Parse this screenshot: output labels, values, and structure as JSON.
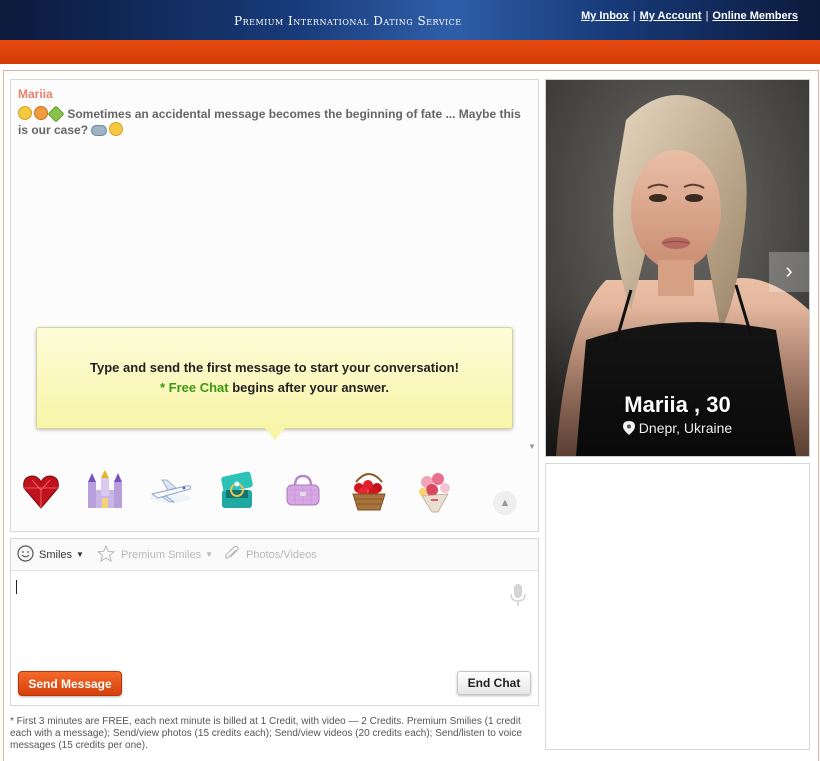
{
  "header": {
    "brand": "Premium International Dating Service",
    "links": [
      "My Inbox",
      "My Account",
      "Online Members"
    ]
  },
  "chat": {
    "sender": "Mariia",
    "message": "Sometimes an accidental message becomes the beginning of fate ... Maybe this is our case?",
    "tooltip_line1": "Type and send the first message to start your conversation!",
    "tooltip_free": "* Free Chat",
    "tooltip_line2_rest": " begins after your answer."
  },
  "gifts": [
    "heart-gem-icon",
    "castle-icon",
    "airplane-icon",
    "ring-box-icon",
    "handbag-icon",
    "rose-basket-icon",
    "bouquet-icon"
  ],
  "toolbar": {
    "smiles": "Smiles",
    "premium_smiles": "Premium Smiles",
    "photos_videos": "Photos/Videos"
  },
  "composer": {
    "value": "",
    "send_label": "Send Message",
    "end_label": "End Chat"
  },
  "note": "* First 3 minutes are FREE, each next minute is billed at 1 Credit, with video — 2 Credits. Premium Smilies (1 credit each with a message); Send/view photos (15 credits each); Send/view videos (20 credits each); Send/listen to voice messages (15 credits per one).",
  "profile": {
    "name_age": "Mariia , 30",
    "location": "Dnepr, Ukraine"
  },
  "colors": {
    "header_bg": "#173a78",
    "red_bar": "#d43a05",
    "send_button": "#e5531a",
    "free_chat": "#3b9a10",
    "sender_name": "#e9826e"
  }
}
